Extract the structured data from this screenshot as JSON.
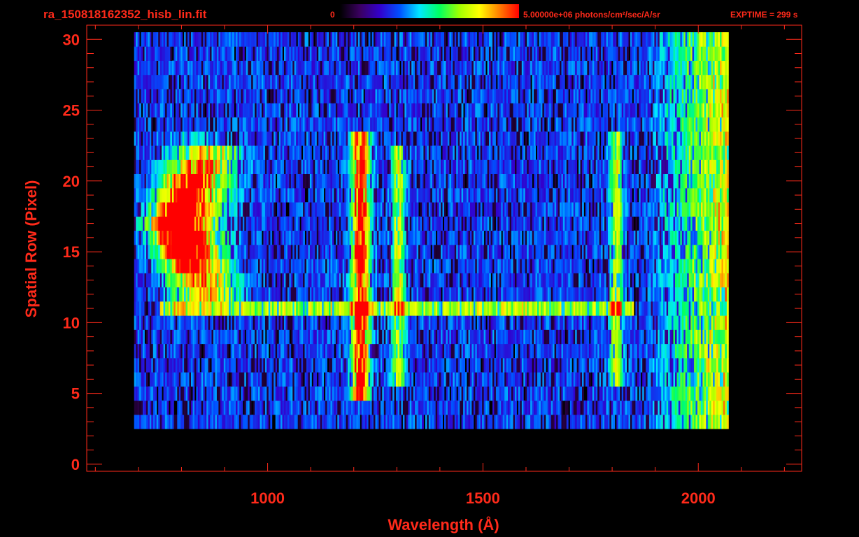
{
  "header": {
    "filename": "ra_150818162352_hisb_lin.fit",
    "colorbar_min": "0",
    "colorbar_max_units": "5.00000e+06 photons/cm²/sec/A/sr",
    "exptime": "EXPTIME = 299 s"
  },
  "colors": {
    "background": "#000000",
    "axes_and_text": "#ff2a1a",
    "colormap": [
      "#000000",
      "#3a0060",
      "#3300cc",
      "#0050ff",
      "#00e8ff",
      "#00ff60",
      "#a0ff00",
      "#ffff00",
      "#ff8000",
      "#ff0000"
    ]
  },
  "chart_data": {
    "type": "heatmap",
    "title": "ra_150818162352_hisb_lin.fit",
    "xlabel": "Wavelength (Å)",
    "ylabel": "Spatial Row (Pixel)",
    "xlim": [
      580,
      2240
    ],
    "ylim": [
      -0.5,
      31
    ],
    "x_ticks": [
      1000,
      1500,
      2000
    ],
    "y_ticks": [
      0,
      5,
      10,
      15,
      20,
      25,
      30
    ],
    "colorbar": {
      "min": 0,
      "max": 5000000,
      "units": "photons/cm²/sec/A/sr",
      "scale": "linear"
    },
    "data_extent": {
      "x": [
        690,
        2070
      ],
      "rows": [
        3,
        30
      ]
    },
    "features": [
      {
        "kind": "emission-line",
        "center_wavelength": 780,
        "rows": [
          11,
          23
        ],
        "peak_fraction": 1.0
      },
      {
        "kind": "emission-line",
        "center_wavelength": 1216,
        "rows": [
          5,
          23
        ],
        "peak_fraction": 0.85
      },
      {
        "kind": "emission-line",
        "center_wavelength": 1304,
        "rows": [
          6,
          22
        ],
        "peak_fraction": 0.5
      },
      {
        "kind": "spatial-band",
        "row": 11,
        "wavelength_range": [
          750,
          1850
        ],
        "peak_fraction": 0.45
      },
      {
        "kind": "emission-line",
        "center_wavelength": 1810,
        "rows": [
          6,
          23
        ],
        "peak_fraction": 0.45
      },
      {
        "kind": "continuum-rise",
        "wavelength_range": [
          1950,
          2070
        ],
        "peak_fraction": 0.6
      }
    ]
  }
}
